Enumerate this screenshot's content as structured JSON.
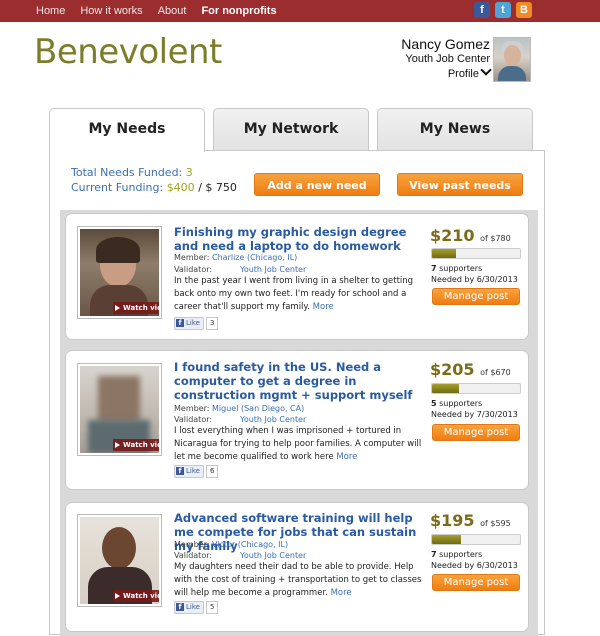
{
  "nav": {
    "items": [
      "Home",
      "How it works",
      "About",
      "For nonprofits"
    ],
    "active_index": 3,
    "social": [
      "facebook-icon",
      "twitter-icon",
      "blogger-icon"
    ]
  },
  "brand": {
    "logo_text": "Benevolent",
    "color": "#7a7d29"
  },
  "user": {
    "name": "Nancy Gomez",
    "org": "Youth Job Center",
    "profile_label": "Profile"
  },
  "tabs": [
    {
      "label": "My Needs",
      "active": true
    },
    {
      "label": "My Network",
      "active": false
    },
    {
      "label": "My News",
      "active": false
    }
  ],
  "stats": {
    "total_label": "Total Needs Funded:",
    "total_value": "3",
    "funding_label": "Current Funding:",
    "funding_value": "$400",
    "funding_goal": "/ $ 750"
  },
  "actions": {
    "add_label": "Add a new need",
    "past_label": "View past needs"
  },
  "needs": [
    {
      "title": "Finishing my graphic design degree and need a laptop to do homework",
      "member_label": "Member:",
      "member": "Charlize (Chicago, IL)",
      "validator_label": "Validator:",
      "validator": "Youth Job Center",
      "description": "In the past year I went from living in a shelter to getting back onto my own two feet. I'm ready for school and a career that'll support my family.",
      "more": "More",
      "like_label": "Like",
      "likes": "3",
      "amount": "$210",
      "goal": "of $780",
      "progress": 0.27,
      "supporters": "7",
      "supporters_label": "supporters",
      "needed_by": "Needed by 6/30/2013",
      "watch_label": "Watch video",
      "manage_label": "Manage post"
    },
    {
      "title": "I found safety in the US. Need a computer to get a degree in construction mgmt + support myself",
      "member_label": "Member:",
      "member": "Miguel (San Diego, CA)",
      "validator_label": "Validator:",
      "validator": "Youth Job Center",
      "description": "I lost everything when I was imprisoned + tortured in Nicaragua for trying to help poor families. A computer will let me become qualified to work here",
      "more": "More",
      "like_label": "Like",
      "likes": "6",
      "amount": "$205",
      "goal": "of $670",
      "progress": 0.31,
      "supporters": "5",
      "supporters_label": "supporters",
      "needed_by": "Needed by 7/30/2013",
      "watch_label": "Watch video",
      "manage_label": "Manage post"
    },
    {
      "title": "Advanced software training will help me compete for jobs that can sustain my family",
      "member_label": "Member:",
      "member": "Victor (Chicago, IL)",
      "validator_label": "Validator:",
      "validator": "Youth Job Center",
      "description": "My daughters need their dad to be able to provide. Help with the cost of training + transportation to get to classes will help me become a programmer.",
      "more": "More",
      "like_label": "Like",
      "likes": "5",
      "amount": "$195",
      "goal": "of $595",
      "progress": 0.33,
      "supporters": "7",
      "supporters_label": "supporters",
      "needed_by": "Needed by 6/30/2013",
      "watch_label": "Watch video",
      "manage_label": "Manage post"
    }
  ]
}
